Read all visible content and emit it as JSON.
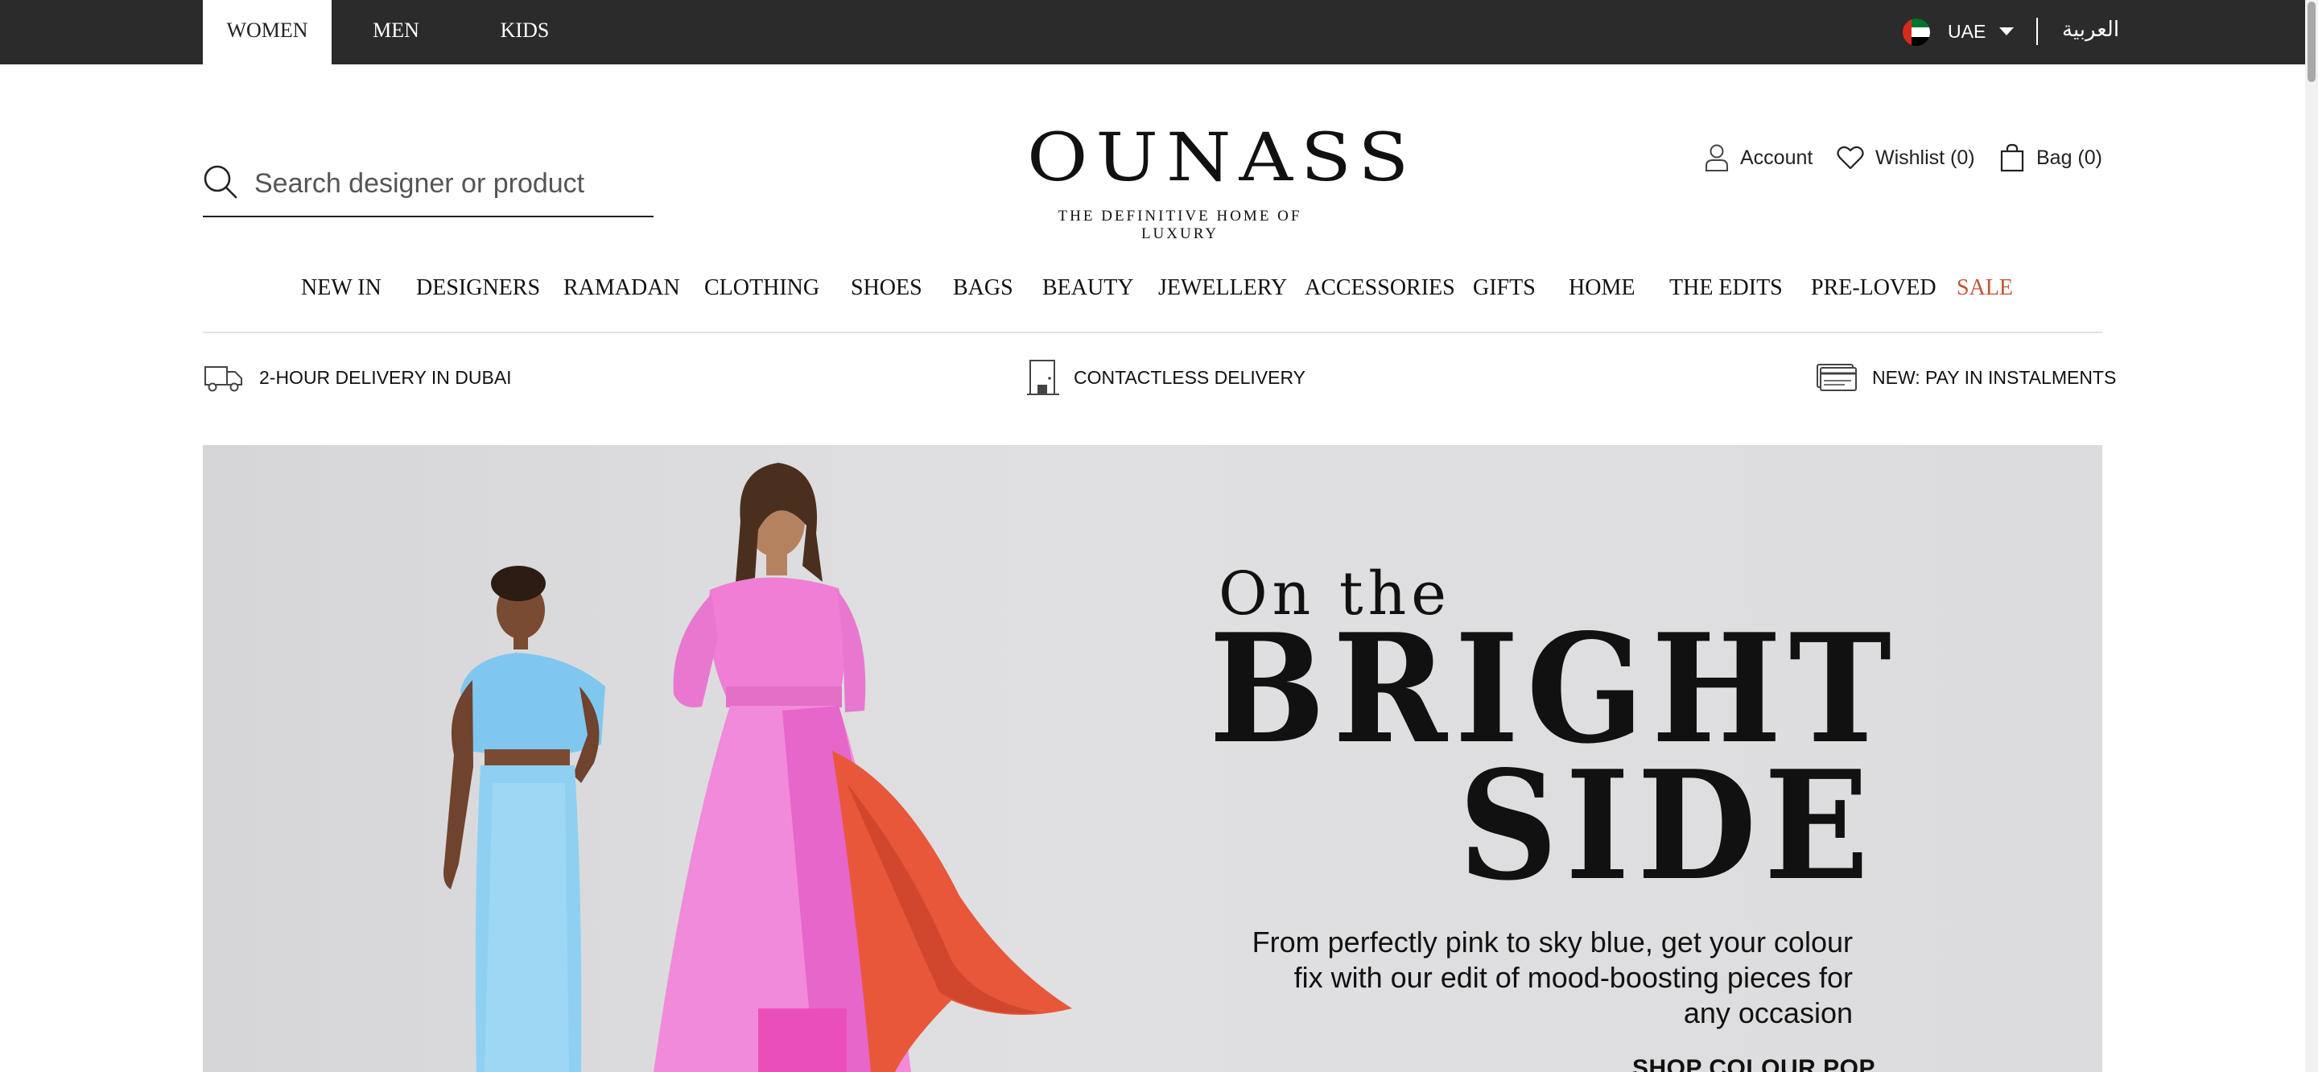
{
  "top_bar": {
    "tabs": [
      {
        "label": "WOMEN",
        "active": true
      },
      {
        "label": "MEN",
        "active": false
      },
      {
        "label": "KIDS",
        "active": false
      }
    ],
    "country": "UAE",
    "language": "العربية"
  },
  "header": {
    "search_placeholder": "Search designer or product",
    "logo": "OUNASS",
    "tagline": "THE DEFINITIVE HOME OF LUXURY",
    "account": "Account",
    "wishlist": "Wishlist (0)",
    "bag": "Bag (0)"
  },
  "main_nav": {
    "items": [
      "NEW IN",
      "DESIGNERS",
      "RAMADAN",
      "CLOTHING",
      "SHOES",
      "BAGS",
      "BEAUTY",
      "JEWELLERY",
      "ACCESSORIES",
      "GIFTS",
      "HOME",
      "THE EDITS",
      "PRE-LOVED",
      "SALE"
    ]
  },
  "delivery_strip": {
    "items": [
      "2-HOUR DELIVERY IN DUBAI",
      "CONTACTLESS DELIVERY",
      "NEW: PAY IN INSTALMENTS"
    ]
  },
  "hero": {
    "headline_1": "On the",
    "headline_2": "BRIGHT",
    "headline_3": "SIDE",
    "description": "From perfectly pink to sky blue, get your colour fix with our edit of mood-boosting pieces for any occasion",
    "cta": "SHOP COLOUR POP"
  },
  "colors": {
    "top_bar_bg": "#2b2b2b",
    "sale_accent": "#c0563a",
    "hero_bg": "#dcdcde"
  }
}
